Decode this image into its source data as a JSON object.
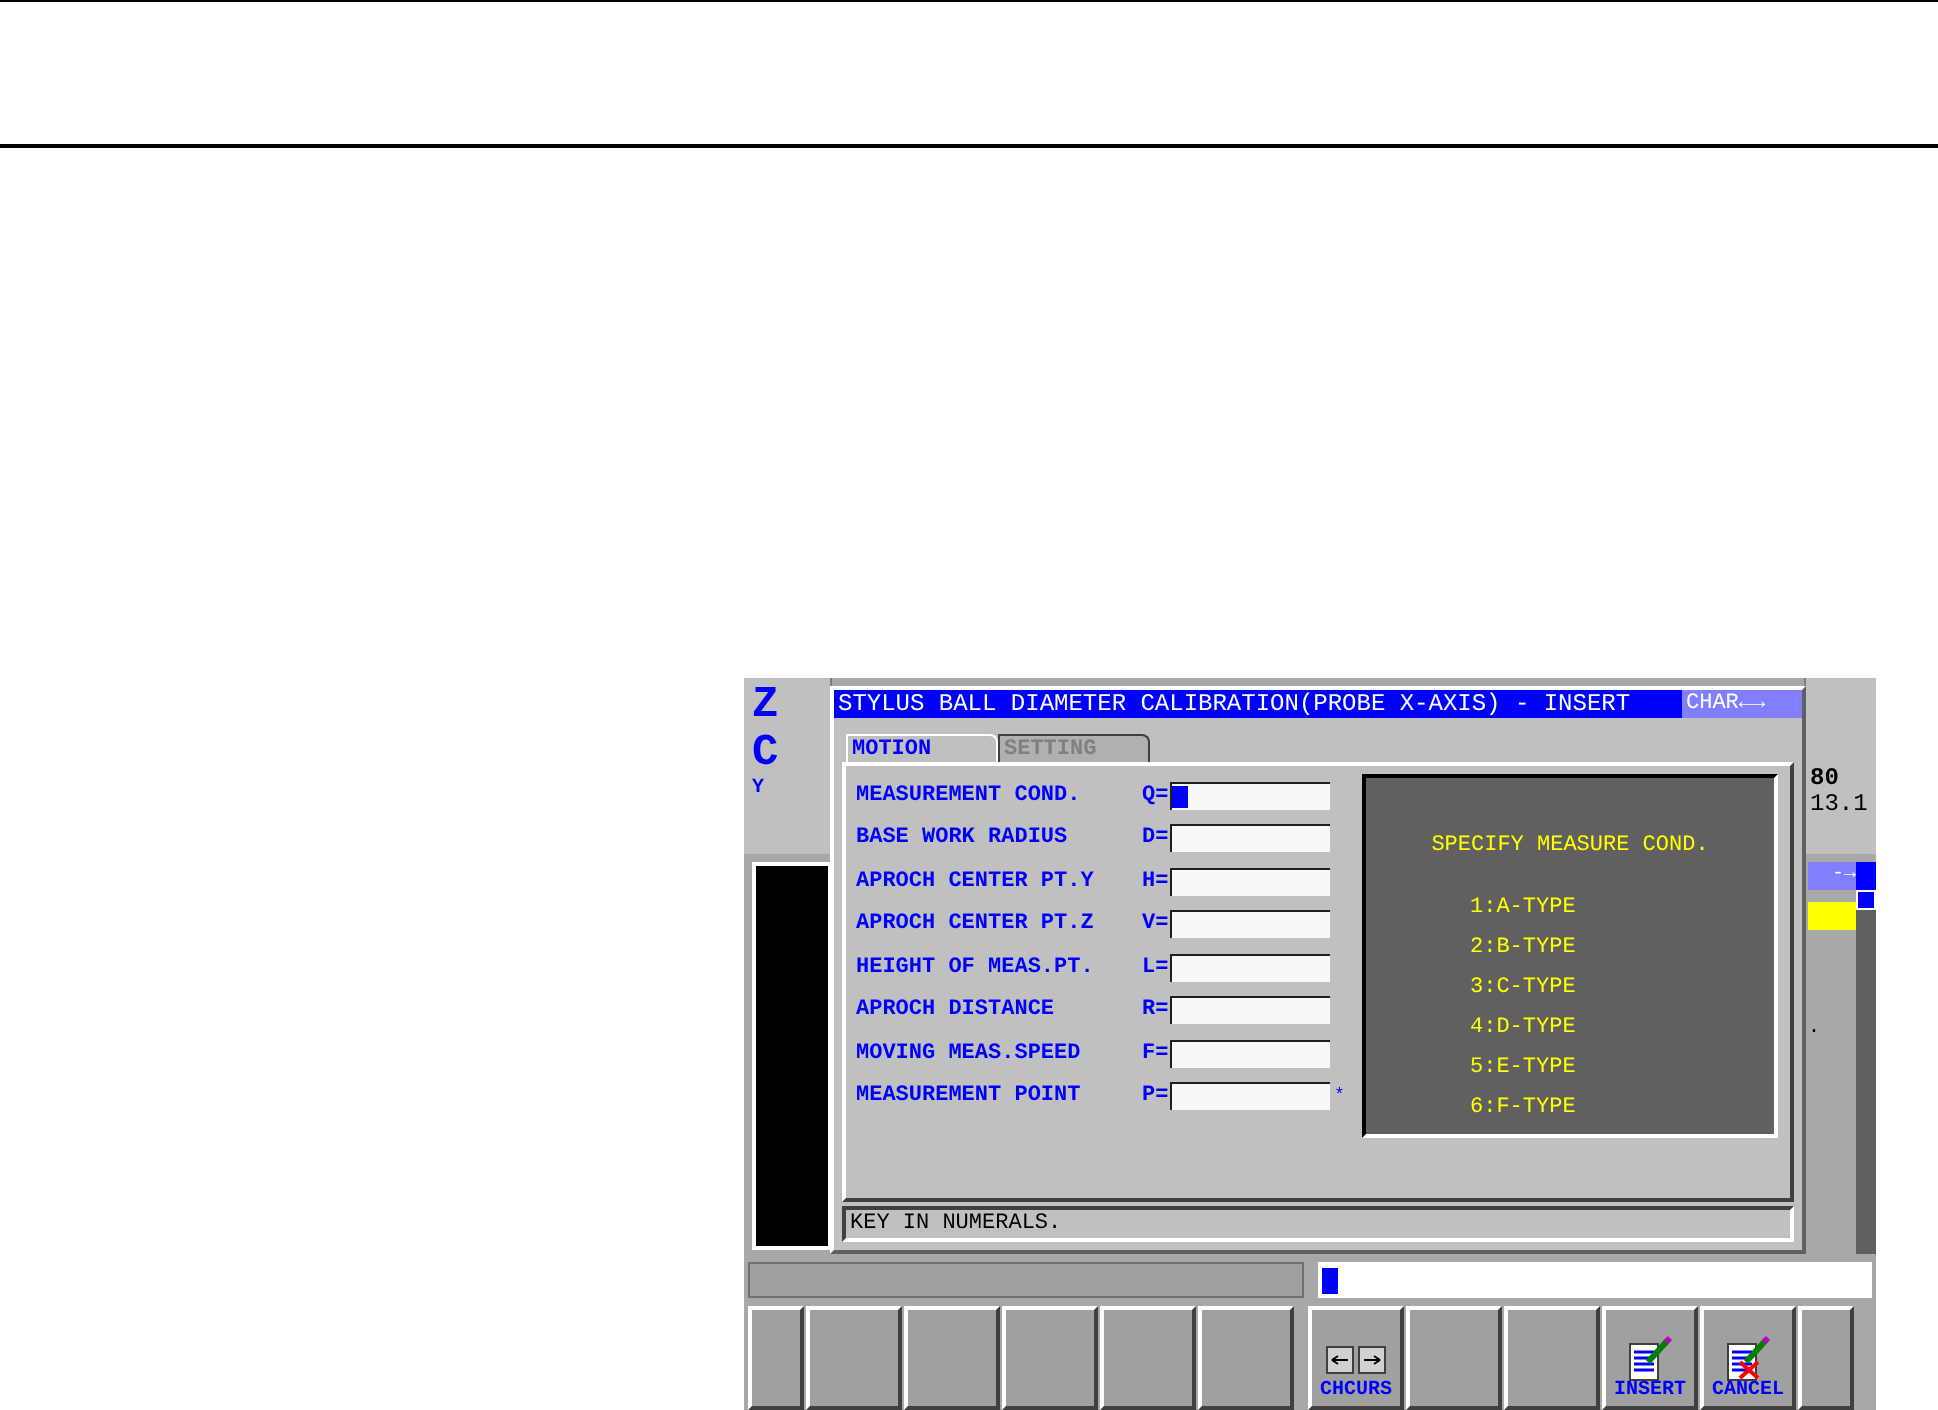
{
  "background": {
    "axis_labels": [
      "Z",
      "C",
      "Y"
    ],
    "readouts": [
      "80",
      "13.1"
    ],
    "cursor_bar": "-→",
    "dot": "."
  },
  "dialog": {
    "title": "STYLUS BALL DIAMETER CALIBRATION(PROBE X-AXIS) - INSERT",
    "mode": "CHAR←→",
    "tabs": [
      {
        "label": "MOTION",
        "selected": true
      },
      {
        "label": "SETTING",
        "selected": false
      }
    ],
    "fields": [
      {
        "label": "MEASUREMENT COND.",
        "letter": "Q=",
        "cursor": true
      },
      {
        "label": "BASE WORK RADIUS",
        "letter": "D=",
        "cursor": false
      },
      {
        "label": "APROCH CENTER PT.Y",
        "letter": "H=",
        "cursor": false
      },
      {
        "label": "APROCH CENTER PT.Z",
        "letter": "V=",
        "cursor": false
      },
      {
        "label": "HEIGHT OF MEAS.PT.",
        "letter": "L=",
        "cursor": false
      },
      {
        "label": "APROCH DISTANCE",
        "letter": "R=",
        "cursor": false
      },
      {
        "label": "MOVING MEAS.SPEED",
        "letter": "F=",
        "cursor": false
      },
      {
        "label": "MEASUREMENT POINT",
        "letter": "P=",
        "cursor": false,
        "suffix": "*"
      }
    ],
    "help": {
      "heading": "SPECIFY MEASURE COND.",
      "options": [
        "1:A-TYPE",
        "2:B-TYPE",
        "3:C-TYPE",
        "4:D-TYPE",
        "5:E-TYPE",
        "6:F-TYPE"
      ]
    },
    "message": "KEY IN NUMERALS."
  },
  "softkeys": {
    "left": [
      {
        "kind": "blank"
      },
      {
        "kind": "blank"
      },
      {
        "kind": "blank"
      },
      {
        "kind": "blank"
      },
      {
        "kind": "blank"
      },
      {
        "kind": "blank"
      }
    ],
    "right": [
      {
        "kind": "cursor",
        "label": "CHCURS"
      },
      {
        "kind": "blank"
      },
      {
        "kind": "blank"
      },
      {
        "kind": "insert",
        "label": "INSERT"
      },
      {
        "kind": "cancel",
        "label": "CANCEL"
      },
      {
        "kind": "blank"
      }
    ]
  }
}
